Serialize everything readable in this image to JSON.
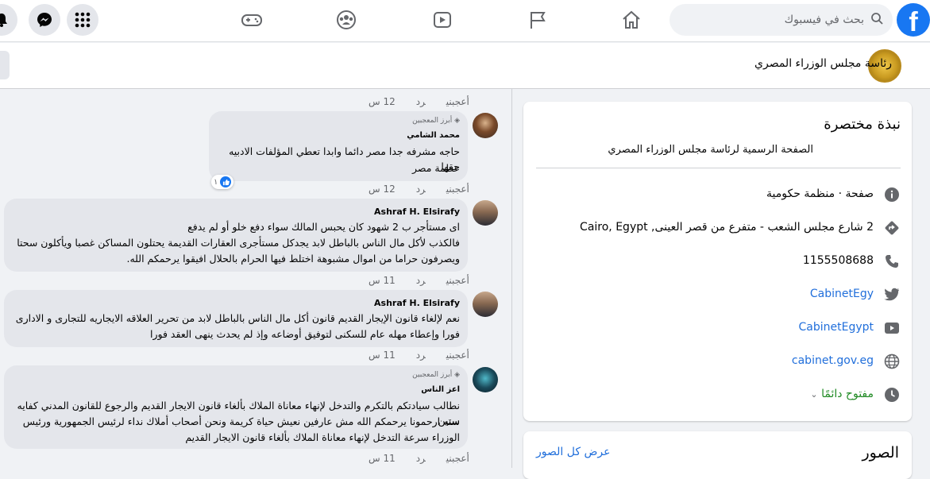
{
  "topbar": {
    "logo": "f",
    "search_placeholder": "بحث في فيسبوك",
    "nav_icons": [
      "home-icon",
      "flag-icon",
      "video-icon",
      "groups-icon",
      "gaming-icon"
    ],
    "right_icons": [
      "menu-grid-icon",
      "messenger-icon",
      "notification-bell-icon"
    ]
  },
  "page_header": {
    "name": "رئاسة مجلس الوزراء المصري"
  },
  "about": {
    "title": "نبذة مختصرة",
    "description": "الصفحة الرسمية لرئاسة مجلس الوزراء المصري",
    "category": "صفحة · منظمة حكومية",
    "address": "2 شارع مجلس الشعب - متفرع من قصر العينى, Cairo, Egypt",
    "phone": "1155508688",
    "twitter": "CabinetEgy",
    "youtube": "CabinetEgypt",
    "website": "cabinet.gov.eg",
    "hours": "مفتوح دائمًا"
  },
  "photos": {
    "title": "الصور",
    "see_all": "عرض كل الصور"
  },
  "comments": {
    "actions": {
      "like": "أعجبني",
      "reply": "رد"
    },
    "top_time": "12 س",
    "items": [
      {
        "badge": "أبرز المعجبين",
        "author": "محمد الشامي",
        "line1": "حاجه مشرفه جدا مصر دائما وابدا تعطي المؤلفات الادبيه حقها",
        "line2": "عظمة مصر",
        "reactions": "١",
        "time": "12 س"
      },
      {
        "author": "Ashraf H. Elsirafy",
        "line1": "اى مستأجر ب 2 شهود كان يحبس المالك سواء دفع خلو أو لم يدفع",
        "line2": "فالكذب لأكل مال الناس بالباطل لابد يجدكل مستأجرى العقارات القديمة يحتلون المساكن غصبا ويأكلون سحتا",
        "line3": "ويصرفون حراما من اموال مشبوهة اختلط فيها الحرام بالحلال افيقوا يرحمكم الله.",
        "time": "11 س"
      },
      {
        "author": "Ashraf H. Elsirafy",
        "line1": "نعم لإلغاء قانون الإيجار القديم قانون أكل مال الناس بالباطل لابد من تحرير العلاقه الايجاريه للتجارى و الادارى",
        "line2": "فورا وإعطاء مهله عام للسكنى لتوفيق أوضاعه وإذ لم يحدث ينهى العقد فورا",
        "time": "11 س"
      },
      {
        "badge": "أبرز المعجبين",
        "author": "اعز الناس",
        "line1": "نطالب سيادتكم بالتكرم والتدخل لإنهاء معاناة الملاك بألغاء قانون الايجار القديم والرجوع للقانون المدني كفايه ستين",
        "line2": "سنه ارحمونا يرحمكم الله مش عارفين نعيش حياة كريمة ونحن أصحاب أملاك نداء لرئيس الجمهورية ورئيس",
        "line3": "الوزراء سرعة التدخل لإنهاء معاناة الملاك بألغاء قانون الايجار القديم",
        "time": "11 س"
      }
    ]
  }
}
